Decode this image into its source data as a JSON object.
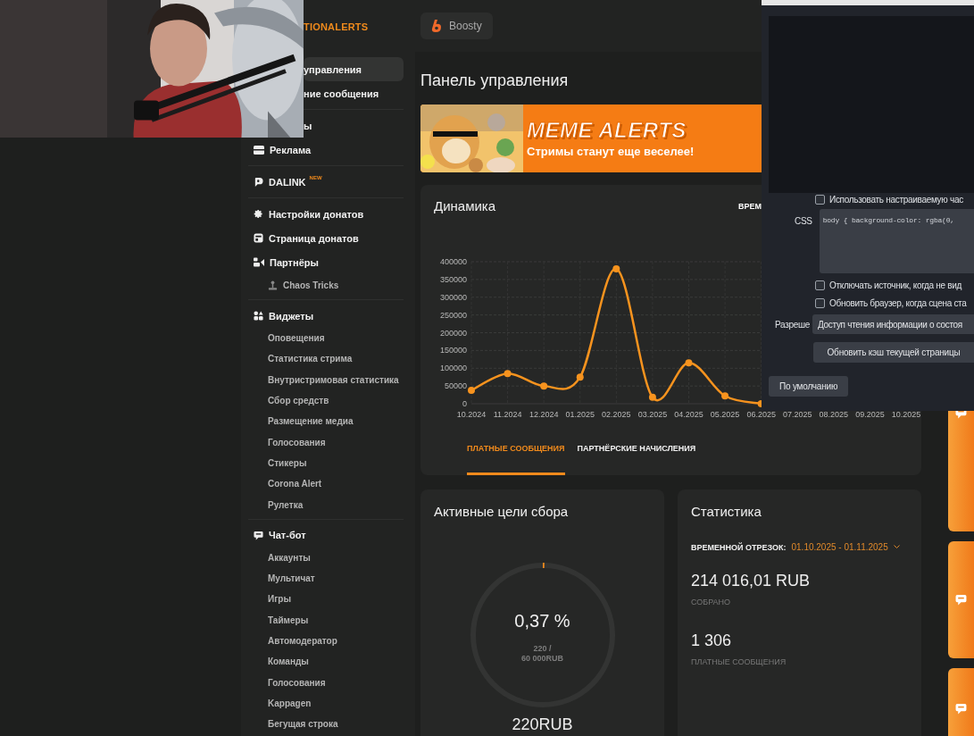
{
  "sidebar": {
    "logo": "TIONALERTS",
    "groups": [
      {
        "items": [
          {
            "kind": "header",
            "label": "управления",
            "selected": true,
            "covered": true
          },
          {
            "kind": "header",
            "label": "ние сообщения",
            "selected": false,
            "covered": true
          }
        ]
      },
      {
        "items": [
          {
            "kind": "header",
            "label": "ы",
            "selected": false,
            "covered": true
          },
          {
            "kind": "header",
            "label": "Реклама",
            "selected": false,
            "covered": false
          }
        ]
      },
      {
        "items": [
          {
            "kind": "header",
            "label": "DALINK",
            "badge": "NEW",
            "selected": false,
            "covered": false
          }
        ]
      },
      {
        "items": [
          {
            "kind": "header",
            "label": "Настройки донатов",
            "selected": false,
            "covered": false
          },
          {
            "kind": "header",
            "label": "Страница донатов",
            "selected": false,
            "covered": false
          },
          {
            "kind": "header",
            "label": "Партнёры",
            "selected": false,
            "covered": false
          },
          {
            "kind": "partner",
            "label": "Chaos Tricks",
            "selected": false,
            "covered": false
          }
        ]
      },
      {
        "items": [
          {
            "kind": "header",
            "label": "Виджеты",
            "selected": false,
            "covered": false
          },
          {
            "kind": "sub",
            "label": "Оповещения",
            "selected": false,
            "covered": false
          },
          {
            "kind": "sub",
            "label": "Статистика стрима",
            "selected": false,
            "covered": false
          },
          {
            "kind": "sub",
            "label": "Внутристримовая статистика",
            "selected": false,
            "covered": false
          },
          {
            "kind": "sub",
            "label": "Сбор средств",
            "selected": false,
            "covered": false
          },
          {
            "kind": "sub",
            "label": "Размещение медиа",
            "selected": false,
            "covered": false
          },
          {
            "kind": "sub",
            "label": "Голосования",
            "selected": false,
            "covered": false
          },
          {
            "kind": "sub",
            "label": "Стикеры",
            "selected": false,
            "covered": false
          },
          {
            "kind": "sub",
            "label": "Corona Alert",
            "selected": false,
            "covered": false
          },
          {
            "kind": "sub",
            "label": "Рулетка",
            "selected": false,
            "covered": false
          }
        ]
      },
      {
        "items": [
          {
            "kind": "header",
            "label": "Чат-бот",
            "selected": false,
            "covered": false
          },
          {
            "kind": "sub",
            "label": "Аккаунты",
            "selected": false,
            "covered": false
          },
          {
            "kind": "sub",
            "label": "Мультичат",
            "selected": false,
            "covered": false
          },
          {
            "kind": "sub",
            "label": "Игры",
            "selected": false,
            "covered": false
          },
          {
            "kind": "sub",
            "label": "Таймеры",
            "selected": false,
            "covered": false
          },
          {
            "kind": "sub",
            "label": "Автомодератор",
            "selected": false,
            "covered": false
          },
          {
            "kind": "sub",
            "label": "Команды",
            "selected": false,
            "covered": false
          },
          {
            "kind": "sub",
            "label": "Голосования",
            "selected": false,
            "covered": false
          },
          {
            "kind": "sub",
            "label": "Kappagen",
            "selected": false,
            "covered": false
          },
          {
            "kind": "sub",
            "label": "Бегущая строка",
            "selected": false,
            "covered": false
          }
        ]
      }
    ]
  },
  "topbar": {
    "boosty_button": "Boosty"
  },
  "page_title": "Панель управления",
  "banner": {
    "title": "MEME ALERTS",
    "subtitle": "Стримы станут еще веселее!"
  },
  "dynamics": {
    "title": "Динамика",
    "period_label": "ВРЕМ",
    "chart_data": {
      "type": "line",
      "categories": [
        "10.2024",
        "11.2024",
        "12.2024",
        "01.2025",
        "02.2025",
        "03.2025",
        "04.2025",
        "05.2025",
        "06.2025",
        "07.2025",
        "08.2025",
        "09.2025",
        "10.2025"
      ],
      "series": [
        {
          "color": "#f7931e",
          "values": [
            38000,
            85000,
            50000,
            75000,
            380000,
            18000,
            115000,
            22000,
            0,
            null,
            null,
            null,
            null
          ]
        }
      ],
      "grid": true,
      "marker": true,
      "ylim": [
        0,
        400000
      ],
      "yticks": [
        0,
        50000,
        100000,
        150000,
        200000,
        250000,
        300000,
        350000,
        400000
      ]
    },
    "tabs": [
      {
        "label": "ПЛАТНЫЕ СООБЩЕНИЯ",
        "selected": true
      },
      {
        "label": "ПАРТНЁРСКИЕ НАЧИСЛЕНИЯ",
        "selected": false
      }
    ]
  },
  "goals": {
    "title": "Активные цели сбора",
    "percent": "0,37 %",
    "level": 0.0037,
    "progress_line1": "220 /",
    "progress_line2": "60 000RUB",
    "amount": "220RUB"
  },
  "stats": {
    "title": "Статистика",
    "period_label": "ВРЕМЕННОЙ ОТРЕЗОК:",
    "period_value": "01.10.2025 - 01.11.2025",
    "collected": "214 016,01 RUB",
    "collected_label": "СОБРАНО",
    "messages": "1 306",
    "messages_label": "ПЛАТНЫЕ СООБЩЕНИЯ"
  },
  "dialog": {
    "checkboxes_top": [
      {
        "label": "Использовать настраиваемую час",
        "checked": false
      }
    ],
    "css_label": "CSS",
    "css_value": "body { background-color: rgba(0,",
    "checkboxes": [
      {
        "label": "Отключать источник, когда не вид",
        "checked": false
      },
      {
        "label": "Обновить браузер, когда сцена ста",
        "checked": false
      }
    ],
    "permission_label": "Разреше",
    "permission_value": "Доступ чтения информации о состоя",
    "refresh_button": "Обновить кэш текущей страницы",
    "default_button": "По умолчанию"
  }
}
